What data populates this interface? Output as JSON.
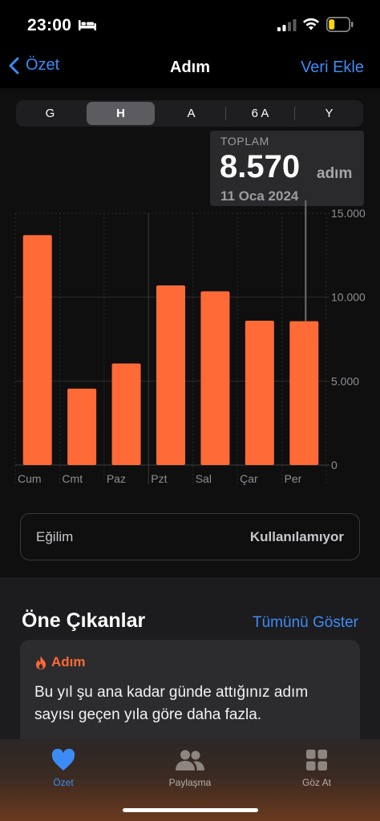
{
  "status": {
    "time": "23:00"
  },
  "nav": {
    "back_label": "Özet",
    "title": "Adım",
    "add_label": "Veri Ekle"
  },
  "segments": [
    "G",
    "H",
    "A",
    "6 A",
    "Y"
  ],
  "selected_segment": "H",
  "summary": {
    "label": "TOPLAM",
    "value": "8.570",
    "unit": "adım",
    "date": "11 Oca 2024"
  },
  "chart_data": {
    "type": "bar",
    "categories": [
      "Cum",
      "Cmt",
      "Paz",
      "Pzt",
      "Sal",
      "Çar",
      "Per"
    ],
    "values": [
      13700,
      4550,
      6050,
      10700,
      10350,
      8600,
      8570
    ],
    "ylim": [
      0,
      15000
    ],
    "yticks": [
      "15.000",
      "10.000",
      "5.000",
      "0"
    ],
    "bar_color": "#ff6a37",
    "selected_index": 6
  },
  "trend": {
    "label": "Eğilim",
    "value": "Kullanılamıyor"
  },
  "highlights": {
    "title": "Öne Çıkanlar",
    "show_all": "Tümünü Göster",
    "card": {
      "category": "Adım",
      "text": "Bu yıl şu ana kadar günde attığınız adım sayısı geçen yıla göre daha fazla."
    }
  },
  "tabs": [
    {
      "label": "Özet",
      "icon": "heart-icon",
      "active": true
    },
    {
      "label": "Paylaşma",
      "icon": "people-icon",
      "active": false
    },
    {
      "label": "Göz At",
      "icon": "grid-icon",
      "active": false
    }
  ],
  "colors": {
    "accent": "#3d8cf5",
    "steps": "#ff6a37"
  }
}
